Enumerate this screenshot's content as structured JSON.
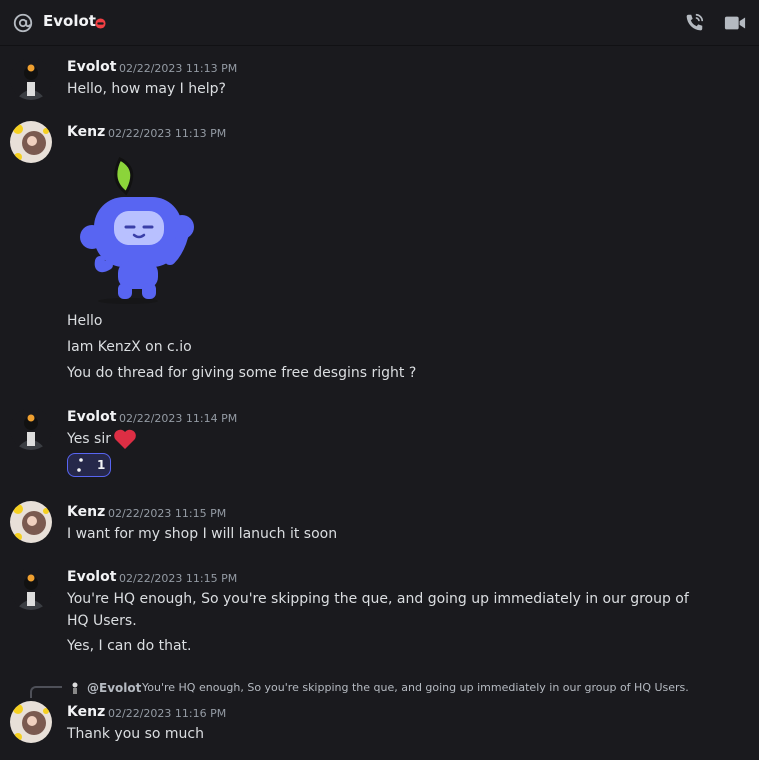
{
  "header": {
    "title": "Evolot",
    "icons": [
      "at-icon",
      "do-not-disturb-icon",
      "voice-call-icon",
      "video-call-icon"
    ]
  },
  "messages": [
    {
      "author": "Evolot",
      "timestamp": "02/22/2023 11:13 PM",
      "lines": [
        "Hello, how may I help?"
      ]
    },
    {
      "author": "Kenz",
      "timestamp": "02/22/2023 11:13 PM",
      "sticker": "wumpus-sticker",
      "lines": [
        "Hello",
        "Iam KenzX on c.io",
        "You do thread for giving some free desgins right ?"
      ]
    },
    {
      "author": "Evolot",
      "timestamp": "02/22/2023 11:14 PM",
      "lines": [
        "Yes sir"
      ],
      "emoji": "red-heart-icon",
      "reaction": {
        "count": "1"
      }
    },
    {
      "author": "Kenz",
      "timestamp": "02/22/2023 11:15 PM",
      "lines": [
        "I want for my shop I will lanuch it soon"
      ]
    },
    {
      "author": "Evolot",
      "timestamp": "02/22/2023 11:15 PM",
      "lines": [
        "You're HQ enough, So you're skipping the que, and going up immediately in our group of HQ Users.",
        "Yes, I can do that."
      ]
    },
    {
      "author": "Kenz",
      "timestamp": "02/22/2023 11:16 PM",
      "lines": [
        "Thank you so much"
      ],
      "reply": {
        "mention": "@Evolot",
        "text": "You're HQ enough, So you're skipping the que, and going up immediately in our group of HQ Users."
      }
    }
  ],
  "colors": {
    "background": "#1a1a1e",
    "accent": "#5865f2",
    "dnd": "#f23f43",
    "heart": "#dd2e44"
  }
}
